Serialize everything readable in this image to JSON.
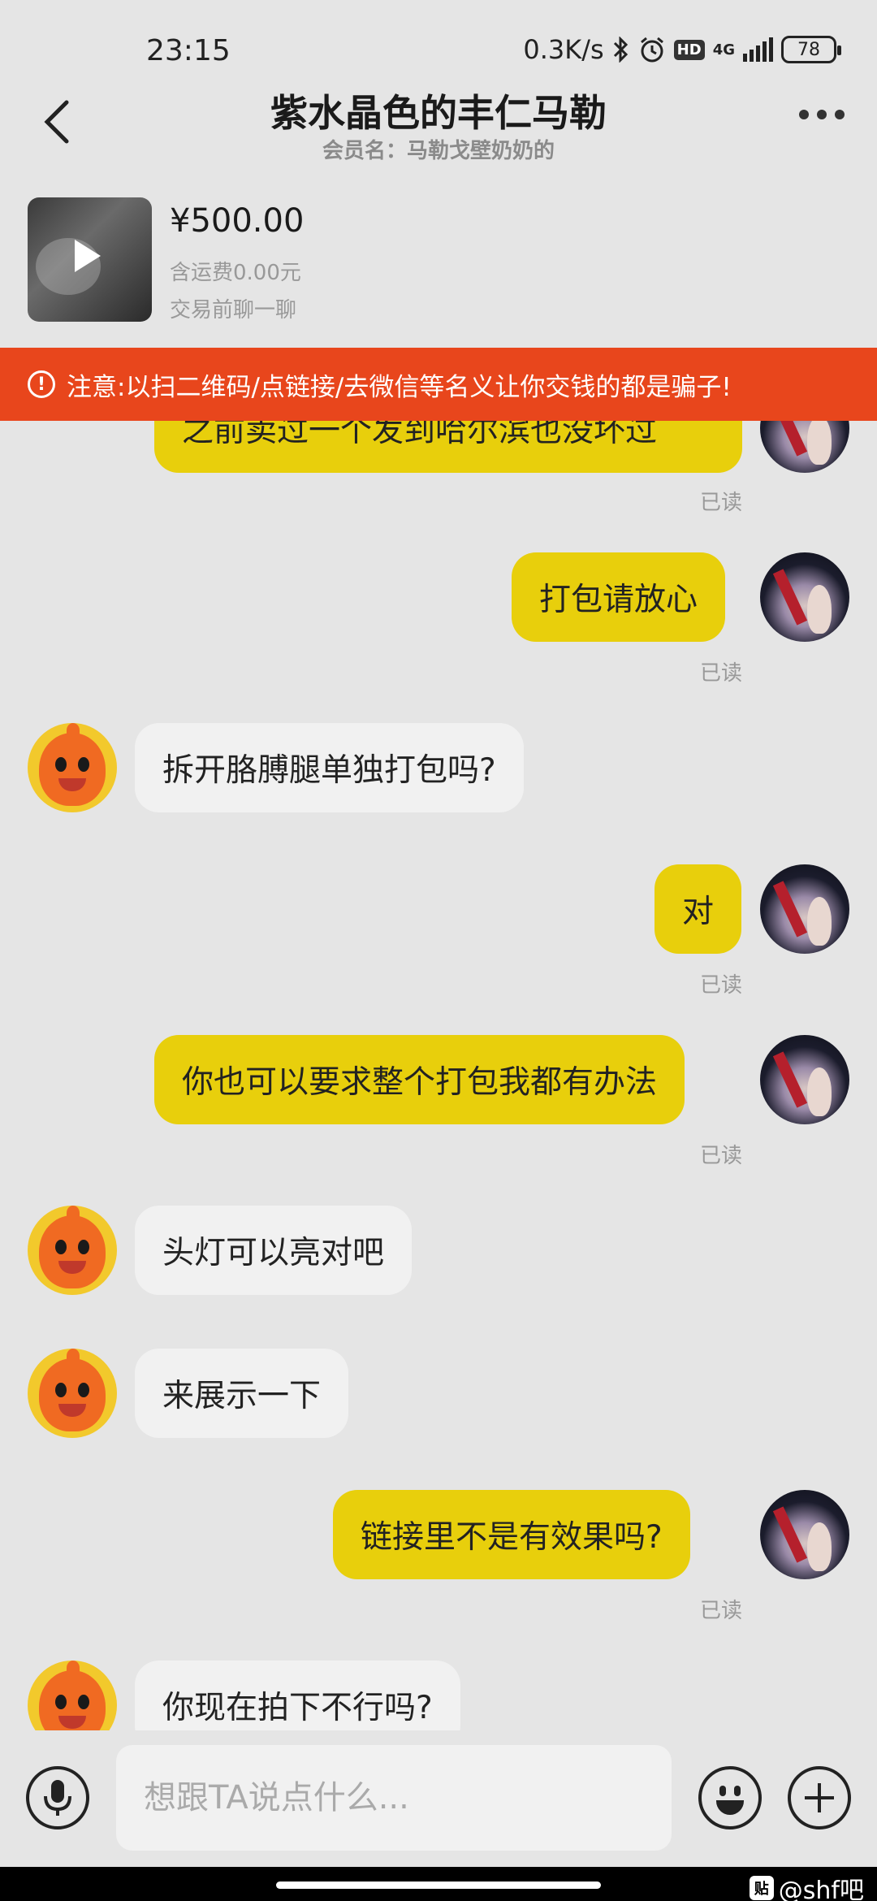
{
  "status_bar": {
    "time": "23:15",
    "network_speed": "0.3K/s",
    "hd_label": "HD",
    "network_type": "4G",
    "battery": "78"
  },
  "header": {
    "title": "紫水晶色的丰仁马勒",
    "subtitle": "会员名：马勒戈壁奶奶的"
  },
  "product": {
    "price": "¥500.00",
    "shipping": "含运费0.00元",
    "chat_note": "交易前聊一聊"
  },
  "warning": {
    "icon": "!",
    "text": "注意:以扫二维码/点链接/去微信等名义让你交钱的都是骗子!"
  },
  "messages": [
    {
      "from": "me",
      "text": "之前卖过一个发到哈尔滨也没坏过",
      "status": "已读"
    },
    {
      "from": "me",
      "text": "打包请放心",
      "status": "已读"
    },
    {
      "from": "them",
      "text": "拆开胳膊腿单独打包吗?"
    },
    {
      "from": "me",
      "text": "对",
      "status": "已读"
    },
    {
      "from": "me",
      "text": "你也可以要求整个打包我都有办法",
      "status": "已读"
    },
    {
      "from": "them",
      "text": "头灯可以亮对吧"
    },
    {
      "from": "them",
      "text": "来展示一下"
    },
    {
      "from": "me",
      "text": "链接里不是有效果吗?",
      "status": "已读"
    },
    {
      "from": "them",
      "text": "你现在拍下不行吗?"
    }
  ],
  "input": {
    "placeholder": "想跟TA说点什么..."
  },
  "watermark": {
    "icon": "贴",
    "text": "@shf吧"
  }
}
